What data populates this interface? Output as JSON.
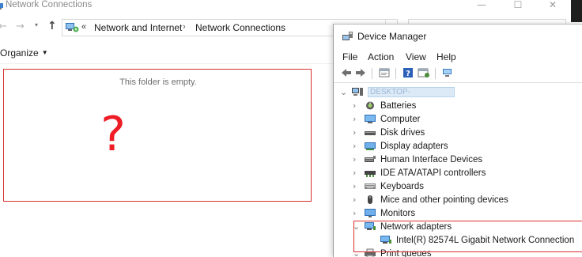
{
  "network_connections": {
    "title": "Network Connections",
    "window_controls": {
      "minimize": "—",
      "maximize": "☐",
      "close": "✕"
    },
    "nav": {
      "back": "←",
      "forward": "→",
      "recent": "▾",
      "up": "↑"
    },
    "address": {
      "overflow": "«",
      "crumbs": [
        "Network and Internet",
        "Network Connections"
      ],
      "separator": "›"
    },
    "toolbar": {
      "organize": "Organize",
      "organize_caret": "▼"
    },
    "content": {
      "empty_message": "This folder is empty.",
      "annotation": "?"
    }
  },
  "device_manager": {
    "title": "Device Manager",
    "menu": [
      "File",
      "Action",
      "View",
      "Help"
    ],
    "tree": {
      "root": {
        "expander": "⌄",
        "name": "DESKTOP-"
      },
      "items": [
        {
          "label": "Batteries",
          "expander": "›",
          "icon": "battery-icon"
        },
        {
          "label": "Computer",
          "expander": "›",
          "icon": "computer-icon"
        },
        {
          "label": "Disk drives",
          "expander": "›",
          "icon": "disk-drive-icon"
        },
        {
          "label": "Display adapters",
          "expander": "›",
          "icon": "display-adapter-icon"
        },
        {
          "label": "Human Interface Devices",
          "expander": "›",
          "icon": "hid-icon"
        },
        {
          "label": "IDE ATA/ATAPI controllers",
          "expander": "›",
          "icon": "ide-controller-icon"
        },
        {
          "label": "Keyboards",
          "expander": "›",
          "icon": "keyboard-icon"
        },
        {
          "label": "Mice and other pointing devices",
          "expander": "›",
          "icon": "mouse-icon"
        },
        {
          "label": "Monitors",
          "expander": "›",
          "icon": "monitor-icon"
        },
        {
          "label": "Network adapters",
          "expander": "⌄",
          "icon": "network-adapter-icon"
        },
        {
          "label": "Intel(R) 82574L Gigabit Network Connection",
          "expander": "",
          "icon": "network-adapter-icon"
        },
        {
          "label": "Print queues",
          "expander": "⌄",
          "icon": "printer-icon"
        }
      ]
    }
  },
  "colors": {
    "annotation_red": "#d8322e",
    "question_red": "#ee1c24",
    "selection_blue": "#dceaf7"
  }
}
